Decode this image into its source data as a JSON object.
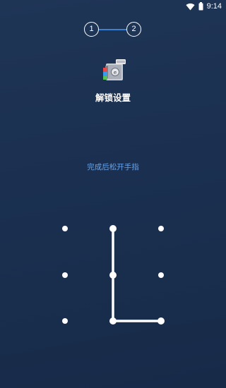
{
  "status_bar": {
    "time": "9:14",
    "icons": [
      "wifi-icon",
      "battery-icon"
    ]
  },
  "stepper": {
    "steps": [
      "1",
      "2"
    ],
    "current_step": "2",
    "connector_color": "#3f7fd0"
  },
  "header": {
    "app_icon": "app-lock-icon",
    "title": "解锁设置"
  },
  "instruction": {
    "text": "完成后松开手指",
    "color": "#6aa2e6"
  },
  "pattern": {
    "grid": "3x3",
    "dots": [
      "1",
      "2",
      "3",
      "4",
      "5",
      "6",
      "7",
      "8",
      "9"
    ],
    "selected_path": [
      "2",
      "5",
      "8",
      "9"
    ],
    "line_color": "#ffffff"
  },
  "colors": {
    "background": "#1c3152",
    "accent": "#3f7fd0"
  }
}
